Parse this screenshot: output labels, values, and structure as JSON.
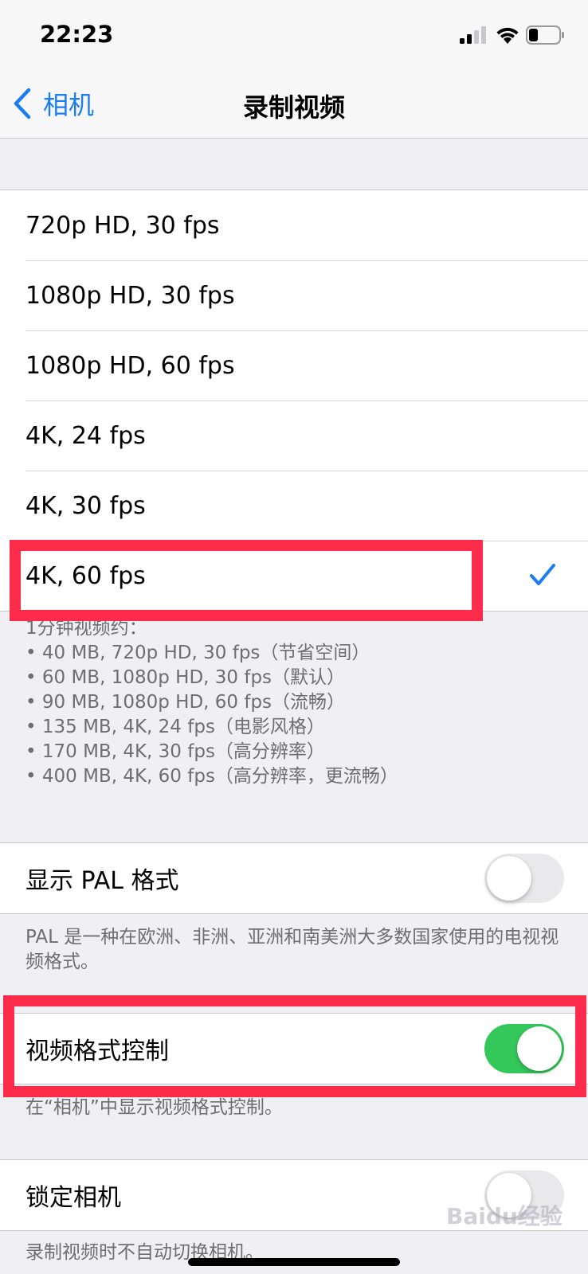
{
  "status": {
    "time": "22:23"
  },
  "nav": {
    "back_label": "相机",
    "title": "录制视频"
  },
  "formats": [
    {
      "label": "720p HD, 30 fps",
      "selected": false
    },
    {
      "label": "1080p HD, 30 fps",
      "selected": false
    },
    {
      "label": "1080p HD, 60 fps",
      "selected": false
    },
    {
      "label": "4K, 24 fps",
      "selected": false
    },
    {
      "label": "4K, 30 fps",
      "selected": false
    },
    {
      "label": "4K, 60 fps",
      "selected": true
    }
  ],
  "size_note": {
    "heading": "1分钟视频约：",
    "lines": [
      "• 40 MB, 720p HD, 30 fps（节省空间）",
      "• 60 MB, 1080p HD, 30 fps（默认）",
      "• 90 MB, 1080p HD, 60 fps（流畅）",
      "• 135 MB, 4K, 24 fps（电影风格）",
      "• 170 MB, 4K, 30 fps（高分辨率）",
      "• 400 MB, 4K, 60 fps（高分辨率，更流畅）"
    ]
  },
  "pal": {
    "label": "显示 PAL 格式",
    "on": false,
    "note": "PAL 是一种在欧洲、非洲、亚洲和南美洲大多数国家使用的电视视频格式。"
  },
  "format_control": {
    "label": "视频格式控制",
    "on": true,
    "note": "在“相机”中显示视频格式控制。"
  },
  "lock_camera": {
    "label": "锁定相机",
    "on": false,
    "note": "录制视频时不自动切换相机。"
  },
  "watermark": "Baidu经验",
  "colors": {
    "accent": "#1a7df2",
    "toggle_on": "#34c759",
    "highlight": "#fc2c4a"
  }
}
